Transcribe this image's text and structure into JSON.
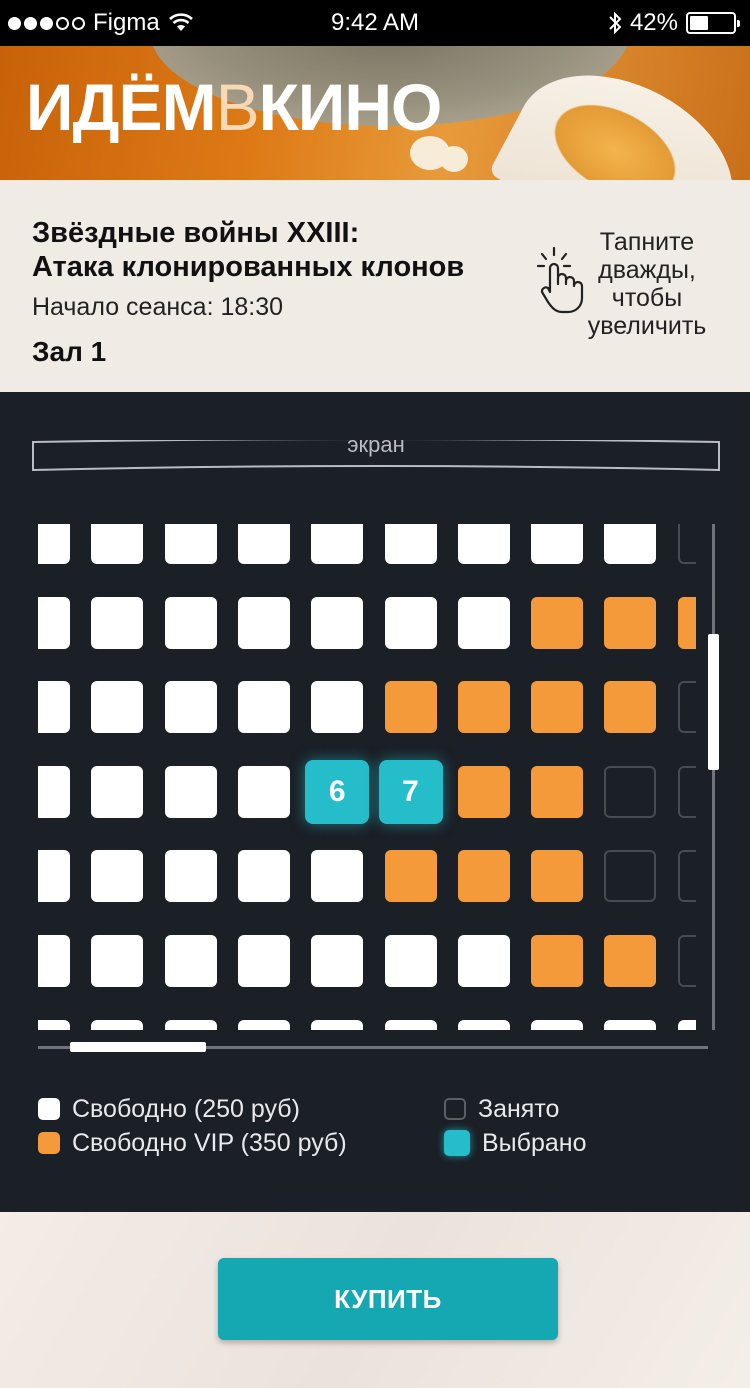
{
  "status_bar": {
    "carrier": "Figma",
    "time": "9:42 AM",
    "battery": "42%",
    "battery_level": 0.42,
    "signal_dots": 3
  },
  "header": {
    "logo_part1": "ИДЁМ",
    "logo_part2": "В",
    "logo_part3": "КИНО"
  },
  "movie": {
    "title_line1": "Звёздные войны XXIII:",
    "title_line2": "Атака клонированных клонов",
    "start_time": "Начало сеанса: 18:30",
    "hall": "Зал 1"
  },
  "hint": {
    "text": "Тапните дважды, чтобы увеличить",
    "icon": "double-tap-hand-icon"
  },
  "seat_map": {
    "screen_label": "экран",
    "rows": [
      [
        "free",
        "free",
        "free",
        "free",
        "free",
        "free",
        "free",
        "free",
        "free",
        "taken"
      ],
      [
        "free",
        "free",
        "free",
        "free",
        "free",
        "free",
        "free",
        "vip",
        "vip",
        "vip"
      ],
      [
        "free",
        "free",
        "free",
        "free",
        "free",
        "vip",
        "vip",
        "vip",
        "vip",
        "taken"
      ],
      [
        "free",
        "free",
        "free",
        "free",
        "selected",
        "selected",
        "vip",
        "vip",
        "taken",
        "taken"
      ],
      [
        "free",
        "free",
        "free",
        "free",
        "free",
        "vip",
        "vip",
        "vip",
        "taken",
        "taken"
      ],
      [
        "free",
        "free",
        "free",
        "free",
        "free",
        "free",
        "free",
        "vip",
        "vip",
        "taken"
      ],
      [
        "free",
        "free",
        "free",
        "free",
        "free",
        "free",
        "free",
        "free",
        "free",
        "free"
      ]
    ],
    "selected_labels": {
      "3-4": "6",
      "3-5": "7"
    }
  },
  "legend": {
    "free": "Свободно (250 руб)",
    "vip": "Свободно VIP (350 руб)",
    "taken": "Занято",
    "selected": "Выбрано"
  },
  "actions": {
    "buy_label": "КУПИТЬ"
  },
  "colors": {
    "accent": "#16a8b2",
    "selected": "#26bdcb",
    "vip": "#f59a3b",
    "map_bg": "#1b1f26"
  }
}
